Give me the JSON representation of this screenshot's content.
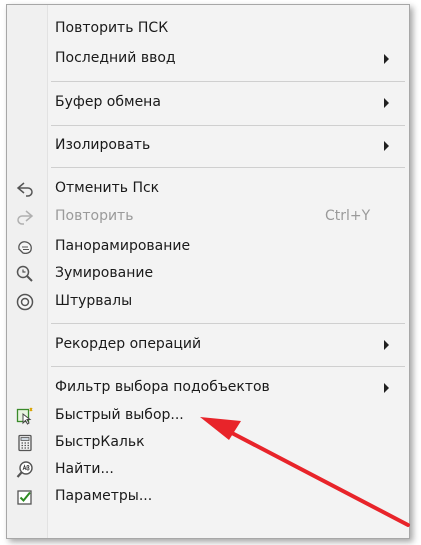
{
  "menu": {
    "items": [
      {
        "label": "Повторить ПСК"
      },
      {
        "label": "Последний ввод"
      },
      {
        "label": "Буфер обмена"
      },
      {
        "label": "Изолировать"
      },
      {
        "label": "Отменить Пск"
      },
      {
        "label": "Повторить",
        "shortcut": "Ctrl+Y"
      },
      {
        "label": "Панорамирование"
      },
      {
        "label": "Зумирование"
      },
      {
        "label": "Штурвалы"
      },
      {
        "label": "Рекордер операций"
      },
      {
        "label": "Фильтр выбора подобъектов"
      },
      {
        "label": "Быстрый выбор..."
      },
      {
        "label": "БыстрКальк"
      },
      {
        "label": "Найти..."
      },
      {
        "label": "Параметры..."
      }
    ]
  },
  "colors": {
    "annotation_arrow": "#e8242a",
    "menu_background": "#f3f3f3",
    "disabled_text": "#9a9a9a"
  }
}
